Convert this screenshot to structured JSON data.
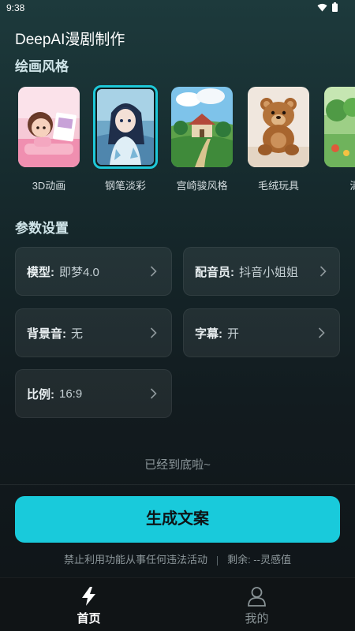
{
  "status_bar": {
    "time": "9:38",
    "icons": [
      "wifi-icon",
      "battery-icon"
    ]
  },
  "app": {
    "title": "DeepAI漫剧制作"
  },
  "sections": {
    "style_title": "绘画风格",
    "params_title": "参数设置"
  },
  "styles": [
    {
      "label": "3D动画",
      "image": "3d-animation-thumbnail",
      "selected": false
    },
    {
      "label": "钢笔淡彩",
      "image": "pen-watercolor-thumbnail",
      "selected": true
    },
    {
      "label": "宫崎骏风格",
      "image": "miyazaki-style-thumbnail",
      "selected": false
    },
    {
      "label": "毛绒玩具",
      "image": "plush-toy-thumbnail",
      "selected": false
    },
    {
      "label": "清",
      "image": "fresh-style-thumbnail",
      "selected": false
    }
  ],
  "params": {
    "model": {
      "key": "模型:",
      "value": "即梦4.0"
    },
    "voice": {
      "key": "配音员:",
      "value": "抖音小姐姐"
    },
    "bgm": {
      "key": "背景音:",
      "value": "无"
    },
    "subtitle": {
      "key": "字幕:",
      "value": "开"
    },
    "ratio": {
      "key": "比例:",
      "value": "16:9"
    }
  },
  "footer_text": "已经到底啦~",
  "generate_button": "生成文案",
  "notice": {
    "warning": "禁止利用功能从事任何违法活动",
    "remaining": "剩余: --灵感值"
  },
  "bottom_nav": [
    {
      "label": "首页",
      "icon": "lightning-icon",
      "active": true
    },
    {
      "label": "我的",
      "icon": "person-icon",
      "active": false
    }
  ],
  "colors": {
    "accent": "#19cadb",
    "background": "#131c20",
    "card": "#1f2a2e",
    "active_nav": "#ffffff",
    "inactive_nav": "#8a9497"
  }
}
